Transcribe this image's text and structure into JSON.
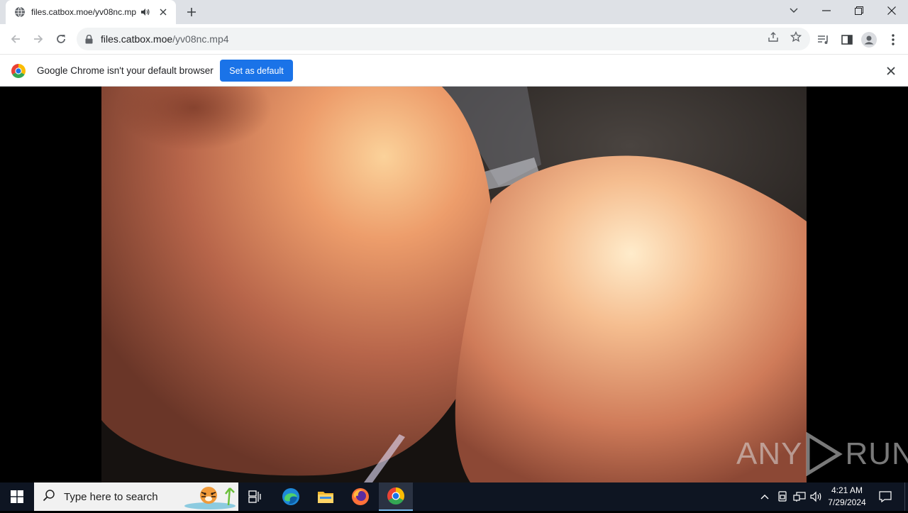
{
  "browser": {
    "tab": {
      "title": "files.catbox.moe/yv08nc.mp4",
      "favicon": "globe-icon",
      "audio": "speaker-icon"
    },
    "toolbar": {
      "url_host": "files.catbox.moe",
      "url_path": "/yv08nc.mp4"
    },
    "infobar": {
      "message": "Google Chrome isn't your default browser",
      "button_label": "Set as default"
    }
  },
  "watermark": {
    "left": "ANY",
    "right": "RUN"
  },
  "taskbar": {
    "search_placeholder": "Type here to search",
    "apps": [
      "task-view",
      "edge",
      "file-explorer",
      "firefox",
      "chrome"
    ],
    "clock": {
      "time": "4:21 AM",
      "date": "7/29/2024"
    }
  },
  "colors": {
    "accent": "#1a73e8",
    "taskbar": "#0e1522",
    "tab_strip": "#dee1e6"
  }
}
